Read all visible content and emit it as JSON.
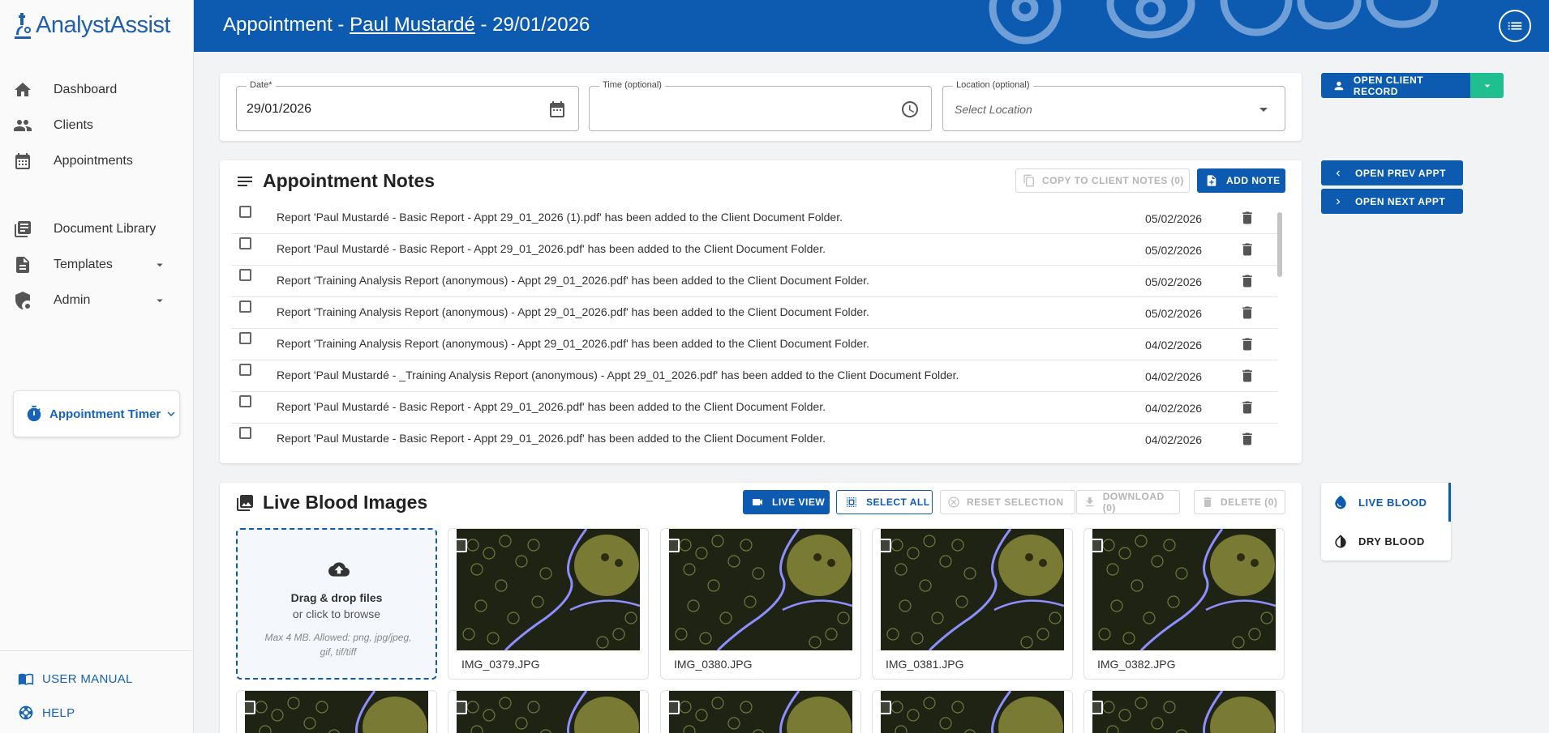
{
  "app": {
    "brand_first": "Analyst",
    "brand_second": "Assist"
  },
  "header": {
    "prefix": "Appointment - ",
    "client_name": "Paul Mustardé",
    "suffix": " - 29/01/2026"
  },
  "sidebar": {
    "items": [
      {
        "label": "Dashboard",
        "icon": "home-icon"
      },
      {
        "label": "Clients",
        "icon": "people-icon"
      },
      {
        "label": "Appointments",
        "icon": "calendar-icon"
      },
      {
        "label": "Document Library",
        "icon": "library-icon"
      },
      {
        "label": "Templates",
        "icon": "document-icon"
      },
      {
        "label": "Admin",
        "icon": "admin-icon"
      }
    ],
    "timer_label": "Appointment Timer",
    "user_manual": "USER MANUAL",
    "help": "HELP"
  },
  "form": {
    "date_label": "Date*",
    "date_value": "29/01/2026",
    "time_label": "Time (optional)",
    "time_value": "",
    "location_label": "Location (optional)",
    "location_placeholder": "Select Location"
  },
  "actions": {
    "open_client_record": "OPEN CLIENT RECORD",
    "open_prev_appt": "OPEN PREV APPT",
    "open_next_appt": "OPEN NEXT APPT"
  },
  "notes": {
    "title": "Appointment Notes",
    "copy_label": "COPY TO CLIENT NOTES (0)",
    "add_label": "ADD NOTE",
    "rows": [
      {
        "text": "Report 'Paul Mustardé - Basic Report - Appt 29_01_2026 (1).pdf' has been added to the Client Document Folder.",
        "date": "05/02/2026"
      },
      {
        "text": "Report 'Paul Mustardé - Basic Report - Appt 29_01_2026.pdf' has been added to the Client Document Folder.",
        "date": "05/02/2026"
      },
      {
        "text": "Report 'Training Analysis Report (anonymous) - Appt 29_01_2026.pdf' has been added to the Client Document Folder.",
        "date": "05/02/2026"
      },
      {
        "text": "Report 'Training Analysis Report (anonymous) - Appt 29_01_2026.pdf' has been added to the Client Document Folder.",
        "date": "05/02/2026"
      },
      {
        "text": "Report 'Training Analysis Report (anonymous) - Appt 29_01_2026.pdf' has been added to the Client Document Folder.",
        "date": "04/02/2026"
      },
      {
        "text": "Report 'Paul Mustardé - _Training Analysis Report (anonymous) - Appt 29_01_2026.pdf' has been added to the Client Document Folder.",
        "date": "04/02/2026"
      },
      {
        "text": "Report 'Paul Mustardé - Basic Report - Appt 29_01_2026.pdf' has been added to the Client Document Folder.",
        "date": "04/02/2026"
      },
      {
        "text": "Report 'Paul Mustarde - Basic Report - Appt 29_01_2026.pdf' has been added to the Client Document Folder.",
        "date": "04/02/2026"
      }
    ]
  },
  "images": {
    "title": "Live Blood Images",
    "live_view": "LIVE VIEW",
    "select_all": "SELECT ALL",
    "reset_selection": "RESET SELECTION",
    "download": "DOWNLOAD (0)",
    "delete": "DELETE (0)",
    "dropzone_title": "Drag & drop files",
    "dropzone_sub": "or click to browse",
    "dropzone_hint": "Max 4 MB. Allowed: png, jpg/jpeg, gif, tif/tiff",
    "files": [
      "IMG_0379.JPG",
      "IMG_0380.JPG",
      "IMG_0381.JPG",
      "IMG_0382.JPG"
    ]
  },
  "blood_nav": {
    "live": "LIVE BLOOD",
    "dry": "DRY BLOOD"
  },
  "colors": {
    "primary": "#0d5bb0",
    "accent_green": "#1fbf8f"
  }
}
